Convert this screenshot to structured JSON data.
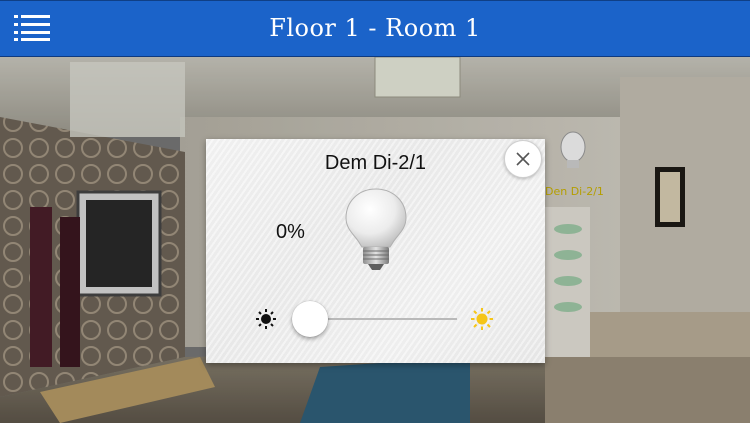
{
  "header": {
    "title": "Floor 1 - Room 1",
    "menu_icon": "list-menu-icon"
  },
  "background": {
    "device_label": "Den Di-2/1"
  },
  "dialog": {
    "title": "Dem Di-2/1",
    "level_text": "0%",
    "level": 0,
    "close_icon": "close-icon",
    "bulb_icon": "light-bulb-icon",
    "min_icon": "sun-dark-icon",
    "max_icon": "sun-bright-icon"
  },
  "colors": {
    "header_blue": "#1b63c9",
    "slider_active": "#1a7cf0",
    "sun_bright": "#f5c518"
  }
}
